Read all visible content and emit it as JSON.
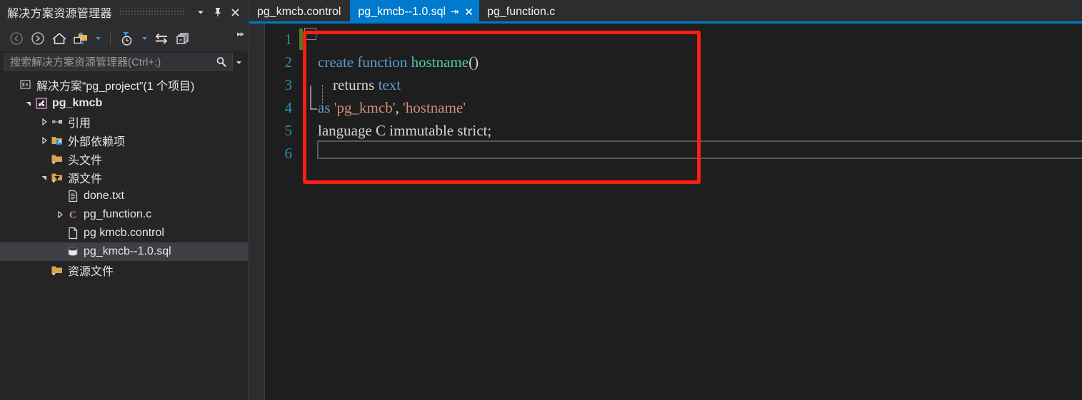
{
  "solution_explorer": {
    "title": "解决方案资源管理器",
    "title_buttons": [
      {
        "name": "dropdown",
        "icon": "chevron-down-icon"
      },
      {
        "name": "pin",
        "icon": "pin-icon"
      },
      {
        "name": "close",
        "icon": "close-icon"
      }
    ],
    "toolbar": [
      {
        "name": "back",
        "icon": "back-arrow-icon"
      },
      {
        "name": "forward",
        "icon": "forward-arrow-icon"
      },
      {
        "name": "home",
        "icon": "home-icon"
      },
      {
        "name": "show-all-files",
        "icon": "show-all-files-icon"
      },
      {
        "name": "show-all-files-dropdown",
        "icon": "chevron-down-icon"
      },
      {
        "name": "pending-changes",
        "icon": "pending-changes-filter-icon"
      },
      {
        "name": "pending-changes-dropdown",
        "icon": "chevron-down-icon"
      },
      {
        "name": "sync-with-active-document",
        "icon": "sync-arrows-icon"
      },
      {
        "name": "collapse-all",
        "icon": "collapse-all-icon"
      }
    ],
    "overflow_label": "▸▸",
    "search": {
      "placeholder": "搜索解决方案资源管理器(Ctrl+;)",
      "value": "",
      "icon": "search-icon",
      "dropdown_icon": "chevron-down-icon"
    },
    "tree": [
      {
        "label": "解决方案“pg_project”(1 个项目)",
        "indent": 0,
        "twist": "none",
        "icon": "solution-icon",
        "bold": false,
        "selected": false
      },
      {
        "label": "pg_kmcb",
        "indent": 1,
        "twist": "expanded",
        "icon": "project-icon",
        "bold": true,
        "selected": false
      },
      {
        "label": "引用",
        "indent": 2,
        "twist": "collapsed",
        "icon": "references-icon",
        "bold": false,
        "selected": false
      },
      {
        "label": "外部依赖项",
        "indent": 2,
        "twist": "collapsed",
        "icon": "external-dependencies-icon",
        "bold": false,
        "selected": false
      },
      {
        "label": "头文件",
        "indent": 2,
        "twist": "none",
        "icon": "folder-filter-icon",
        "bold": false,
        "selected": false
      },
      {
        "label": "源文件",
        "indent": 2,
        "twist": "expanded",
        "icon": "folder-filter-open-icon",
        "bold": false,
        "selected": false
      },
      {
        "label": "done.txt",
        "indent": 3,
        "twist": "none",
        "icon": "text-file-icon",
        "bold": false,
        "selected": false
      },
      {
        "label": "pg_function.c",
        "indent": 3,
        "twist": "collapsed",
        "icon": "c-file-icon",
        "bold": false,
        "selected": false
      },
      {
        "label": "pg kmcb.control",
        "indent": 3,
        "twist": "none",
        "icon": "blank-file-icon",
        "bold": false,
        "selected": false
      },
      {
        "label": "pg_kmcb--1.0.sql",
        "indent": 3,
        "twist": "none",
        "icon": "database-file-icon",
        "bold": false,
        "selected": true
      },
      {
        "label": "资源文件",
        "indent": 2,
        "twist": "none",
        "icon": "folder-filter-icon",
        "bold": false,
        "selected": false
      }
    ]
  },
  "editor": {
    "tabs": [
      {
        "label": "pg_kmcb.control",
        "active": false
      },
      {
        "label": "pg_kmcb--1.0.sql",
        "active": true,
        "pin_icon": "pin-icon",
        "close_icon": "close-icon"
      },
      {
        "label": "pg_function.c",
        "active": false
      }
    ],
    "lines": [
      {
        "num": "1",
        "tokens": []
      },
      {
        "num": "2",
        "tokens": [
          {
            "t": "create function ",
            "c": "kw"
          },
          {
            "t": "hostname",
            "c": "fn"
          },
          {
            "t": "()",
            "c": "pln"
          }
        ]
      },
      {
        "num": "3",
        "tokens": [
          {
            "t": "    returns ",
            "c": "pln"
          },
          {
            "t": "text",
            "c": "type"
          }
        ]
      },
      {
        "num": "4",
        "tokens": [
          {
            "t": "as ",
            "c": "kw"
          },
          {
            "t": "'pg_kmcb'",
            "c": "str"
          },
          {
            "t": ", ",
            "c": "pln"
          },
          {
            "t": "'hostname'",
            "c": "str"
          }
        ]
      },
      {
        "num": "5",
        "tokens": [
          {
            "t": "language C immutable strict;",
            "c": "pln"
          }
        ]
      },
      {
        "num": "6",
        "tokens": []
      }
    ]
  },
  "colors": {
    "accent": "#007acc",
    "panel_bg": "#252526",
    "editor_bg": "#1e1e1e",
    "keyword": "#569cd6",
    "function": "#4ec9b0",
    "string": "#ce9178",
    "plain": "#d4d4d4",
    "line_number": "#2b91af",
    "selection": "#3f3f46",
    "annotation": "#fc1e13",
    "change_bar": "#4f7a28"
  }
}
